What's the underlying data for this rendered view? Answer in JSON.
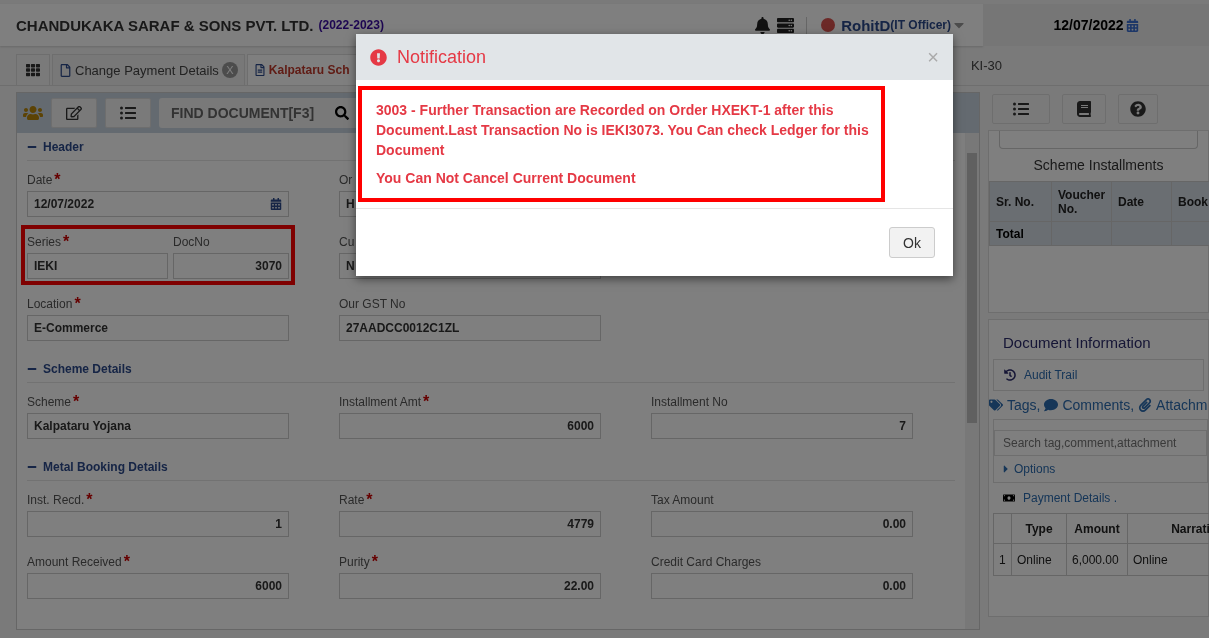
{
  "header": {
    "company": "CHANDUKAKA SARAF & SONS PVT. LTD.",
    "year": "(2022-2023)",
    "user": "RohitD",
    "role": "(IT Officer)",
    "date": "12/07/2022"
  },
  "tabs": [
    {
      "label": "Change Payment Details",
      "selected": false,
      "closable": true,
      "close": "X"
    },
    {
      "label": "Kalpataru Sch",
      "selected": true,
      "closable": false
    }
  ],
  "tab_overflow": "KI-30",
  "toolbar": {
    "search_placeholder": "FIND DOCUMENT[F3]"
  },
  "sections": [
    {
      "title": "Header",
      "expanded": true,
      "rows": [
        [
          {
            "label": "Date",
            "marker": "*",
            "value": "12/07/2022",
            "kind": "date"
          },
          {
            "label": "Or",
            "value": "H",
            "kind": "text"
          }
        ],
        [
          {
            "kind": "pair",
            "highlighted": true,
            "fields": [
              {
                "label": "Series",
                "marker": "*",
                "value": "IEKI",
                "kind": "text"
              },
              {
                "label": "DocNo",
                "value": "3070",
                "kind": "number"
              }
            ]
          },
          {
            "label": "Cu",
            "value": "N",
            "kind": "text"
          }
        ],
        [
          {
            "label": "Location",
            "marker": "*",
            "value": "E-Commerce",
            "kind": "text"
          },
          {
            "label": "Our GST No",
            "value": "27AADCC0012C1ZL",
            "kind": "text"
          }
        ]
      ]
    },
    {
      "title": "Scheme Details",
      "expanded": true,
      "rows": [
        [
          {
            "label": "Scheme",
            "marker": "*",
            "value": "Kalpataru Yojana",
            "kind": "text"
          },
          {
            "label": "Installment Amt",
            "marker": "*",
            "value": "6000",
            "kind": "number"
          },
          {
            "label": "Installment No",
            "value": "7",
            "kind": "number"
          }
        ]
      ]
    },
    {
      "title": "Metal Booking Details",
      "expanded": true,
      "rows": [
        [
          {
            "label": "Inst. Recd.",
            "marker": "*",
            "value": "1",
            "kind": "number"
          },
          {
            "label": "Rate",
            "marker": "*",
            "value": "4779",
            "kind": "number"
          },
          {
            "label": "Tax Amount",
            "value": "0.00",
            "kind": "number"
          }
        ],
        [
          {
            "label": "Amount Received",
            "marker": "*",
            "value": "6000",
            "kind": "number"
          },
          {
            "label": "Purity",
            "marker": "*",
            "value": "22.00",
            "kind": "number"
          },
          {
            "label": "Credit Card Charges",
            "value": "0.00",
            "kind": "number"
          }
        ]
      ]
    }
  ],
  "side": {
    "installments_title": "Scheme Installments",
    "installments_columns": [
      "Sr. No.",
      "Voucher No.",
      "Date",
      "Book"
    ],
    "installments_total": "Total",
    "doc_info_title": "Document Information",
    "audit_trail": "Audit Trail",
    "tags": [
      "Tags,",
      "Comments,",
      "Attachm"
    ],
    "tag_search_placeholder": "Search tag,comment,attachment",
    "options": "Options",
    "payment_title": "Payment Details .",
    "payment_columns": [
      "",
      "Type",
      "Amount",
      "Narrati"
    ],
    "payment_rows": [
      [
        "1",
        "Online",
        "6,000.00",
        "Online"
      ]
    ]
  },
  "dialog": {
    "title": "Notification",
    "close": "×",
    "messages": [
      "3003 - Further Transaction are Recorded on Order HXEKT-1 after this Document.Last Transaction No is IEKI3073. You Can check Ledger for this Document",
      "You Can Not Cancel Current Document"
    ],
    "button": "Ok"
  }
}
